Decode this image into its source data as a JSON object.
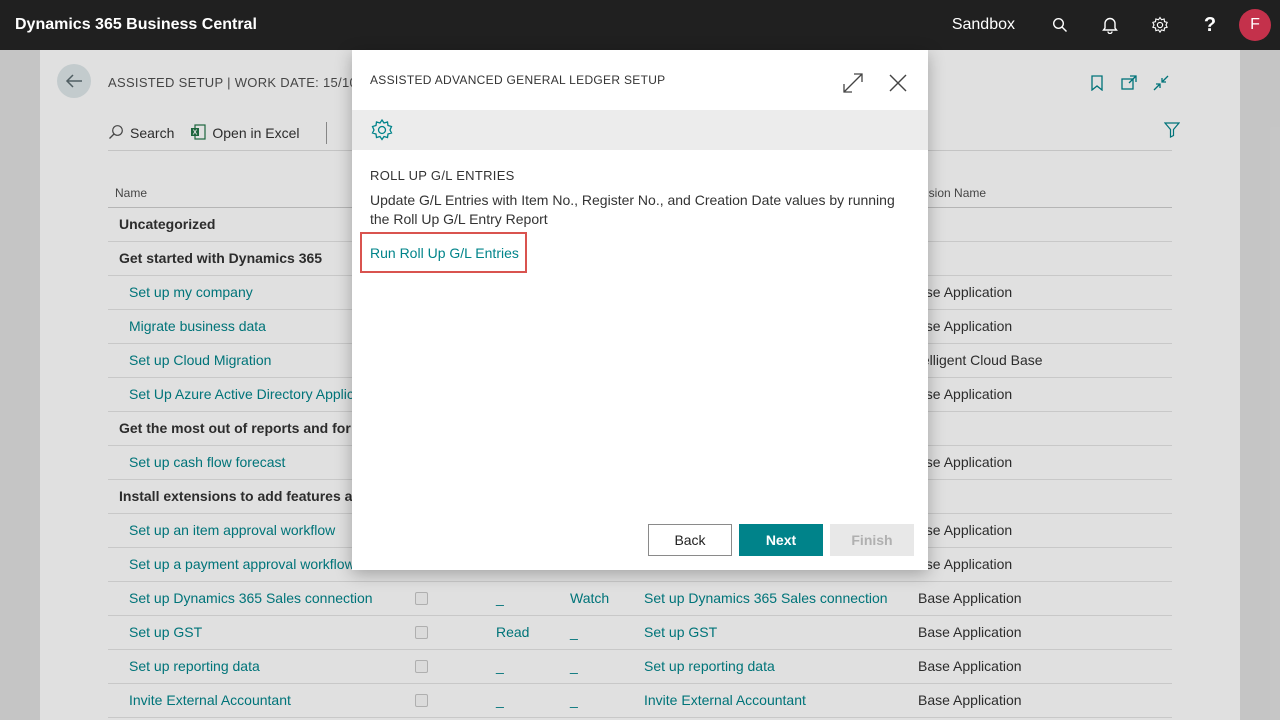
{
  "topbar": {
    "app_title": "Dynamics 365 Business Central",
    "environment": "Sandbox",
    "avatar_initial": "F",
    "icons": [
      "search-icon",
      "bell-icon",
      "gear-icon",
      "help-icon"
    ]
  },
  "page": {
    "title": "ASSISTED SETUP | WORK DATE: 15/10/2",
    "actions": {
      "search": "Search",
      "open_in_excel": "Open in Excel"
    },
    "columns": {
      "name": "Name",
      "extension_name": "nsion Name"
    },
    "rows": [
      {
        "type": "group",
        "name": "Uncategorized"
      },
      {
        "type": "group",
        "name": "Get started with Dynamics 365"
      },
      {
        "type": "item",
        "name": "Set up my company",
        "ext": "ase Application"
      },
      {
        "type": "item",
        "name": "Migrate business data",
        "ext": "ase Application"
      },
      {
        "type": "item",
        "name": "Set up Cloud Migration",
        "ext": "telligent Cloud Base"
      },
      {
        "type": "item",
        "name": "Set Up Azure Active Directory Applic",
        "ext": "ase Application"
      },
      {
        "type": "group",
        "name": "Get the most out of reports and for"
      },
      {
        "type": "item",
        "name": "Set up cash flow forecast",
        "ext": "ase Application"
      },
      {
        "type": "group",
        "name": "Install extensions to add features ar"
      },
      {
        "type": "item",
        "name": "Set up an item approval workflow",
        "ext": "ase Application"
      },
      {
        "type": "item",
        "name": "Set up a payment approval workflow",
        "ext": "ase Application"
      },
      {
        "type": "item",
        "name": "Set up Dynamics 365 Sales connection",
        "check": true,
        "read": "_",
        "watch": "Watch",
        "help": "Set up Dynamics 365 Sales connection",
        "ext": "Base Application"
      },
      {
        "type": "item",
        "name": "Set up GST",
        "check": true,
        "read": "Read",
        "watch": "_",
        "help": "Set up GST",
        "ext": "Base Application"
      },
      {
        "type": "item",
        "name": "Set up reporting data",
        "check": true,
        "read": "_",
        "watch": "_",
        "help": "Set up reporting data",
        "ext": "Base Application"
      },
      {
        "type": "item",
        "name": "Invite External Accountant",
        "check": true,
        "read": "_",
        "watch": "_",
        "help": "Invite External Accountant",
        "ext": "Base Application"
      }
    ]
  },
  "dialog": {
    "title": "ASSISTED ADVANCED GENERAL LEDGER SETUP",
    "heading": "ROLL UP G/L ENTRIES",
    "description": "Update G/L Entries with Item No., Register No., and Creation Date values by running the Roll Up G/L Entry Report",
    "link": "Run Roll Up G/L Entries",
    "buttons": {
      "back": "Back",
      "next": "Next",
      "finish": "Finish"
    }
  },
  "colors": {
    "accent": "#00838a",
    "topbar": "#202020",
    "avatar": "#c4314b",
    "highlight": "#d9534f"
  }
}
